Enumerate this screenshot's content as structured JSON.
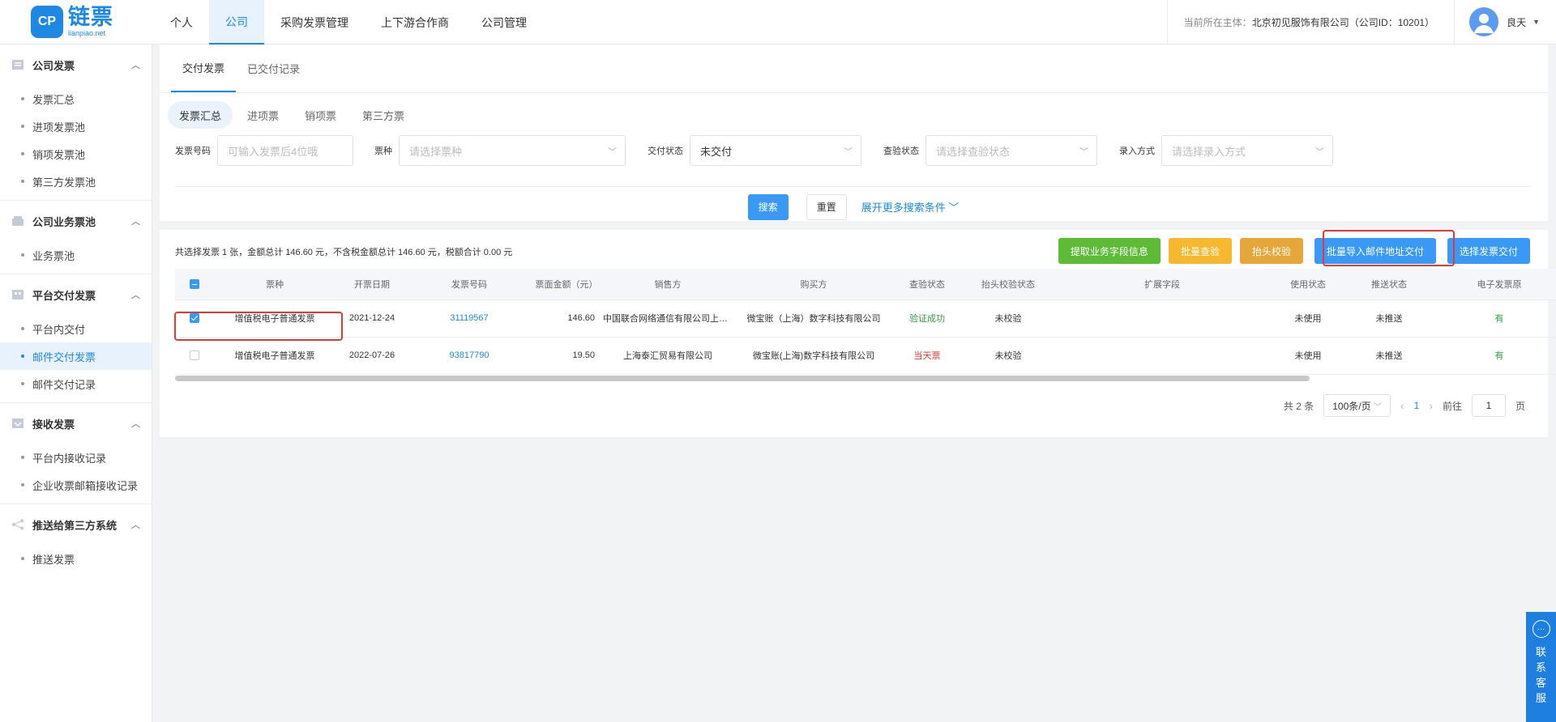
{
  "header": {
    "logo_mark": "CP",
    "logo_cn": "链票",
    "logo_en": "lianpiao.net",
    "nav": [
      {
        "label": "个人",
        "active": false
      },
      {
        "label": "公司",
        "active": true
      },
      {
        "label": "采购发票管理",
        "active": false
      },
      {
        "label": "上下游合作商",
        "active": false
      },
      {
        "label": "公司管理",
        "active": false
      }
    ],
    "entity_label": "当前所在主体：",
    "entity_value": "北京初见服饰有限公司（公司ID：10201）",
    "user_name": "良天",
    "user_caret": "▼"
  },
  "sidebar": {
    "groups": [
      {
        "title": "公司发票",
        "icon": "invoice-icon",
        "items": [
          "发票汇总",
          "进项发票池",
          "销项发票池",
          "第三方发票池"
        ]
      },
      {
        "title": "公司业务票池",
        "icon": "pool-icon",
        "items": [
          "业务票池"
        ]
      },
      {
        "title": "平台交付发票",
        "icon": "deliver-icon",
        "items": [
          "平台内交付",
          "邮件交付发票",
          "邮件交付记录"
        ]
      },
      {
        "title": "接收发票",
        "icon": "receive-icon",
        "items": [
          "平台内接收记录",
          "企业收票邮箱接收记录"
        ]
      },
      {
        "title": "推送给第三方系统",
        "icon": "share-icon",
        "items": [
          "推送发票"
        ]
      }
    ],
    "active_item": "邮件交付发票"
  },
  "tabs": [
    "交付发票",
    "已交付记录"
  ],
  "subtabs": [
    "发票汇总",
    "进项票",
    "销项票",
    "第三方票"
  ],
  "filters": {
    "invoice_no_label": "发票号码",
    "invoice_no_placeholder": "可输入发票后4位哦",
    "type_label": "票种",
    "type_placeholder": "请选择票种",
    "delivery_label": "交付状态",
    "delivery_value": "未交付",
    "check_label": "查验状态",
    "check_placeholder": "请选择查验状态",
    "entry_label": "录入方式",
    "entry_placeholder": "请选择录入方式"
  },
  "buttons": {
    "search": "搜索",
    "reset": "重置",
    "more": "展开更多搜索条件 ﹀"
  },
  "summary": "共选择发票 1 张，金额总计 146.60 元，不含税金额总计 146.60 元，税额合计 0.00 元",
  "actions": [
    {
      "label": "提取业务字段信息",
      "color": "#5dbb37"
    },
    {
      "label": "批量查验",
      "color": "#f5b82e"
    },
    {
      "label": "抬头校验",
      "color": "#e5a73a"
    },
    {
      "label": "批量导入邮件地址交付",
      "color": "#3a99f5"
    },
    {
      "label": "选择发票交付",
      "color": "#3a99f5"
    }
  ],
  "table": {
    "columns": [
      "票种",
      "开票日期",
      "发票号码",
      "票面金额（元）",
      "销售方",
      "购买方",
      "查验状态",
      "抬头校验状态",
      "扩展字段",
      "使用状态",
      "推送状态",
      "电子发票原"
    ],
    "rows": [
      {
        "checked": true,
        "type": "增值税电子普通发票",
        "date": "2021-12-24",
        "no": "31119567",
        "amount": "146.60",
        "seller": "中国联合网络通信有限公司上海…",
        "buyer": "微宝账（上海）数字科技有限公司",
        "check": "验证成功",
        "title_check": "未校验",
        "ext": "",
        "use": "未使用",
        "push": "未推送",
        "orig": "有"
      },
      {
        "checked": false,
        "type": "增值税电子普通发票",
        "date": "2022-07-26",
        "no": "93817790",
        "amount": "19.50",
        "seller": "上海泰汇贸易有限公司",
        "buyer": "微宝账(上海)数字科技有限公司",
        "check": "当天票",
        "title_check": "未校验",
        "ext": "",
        "use": "未使用",
        "push": "未推送",
        "orig": "有"
      }
    ]
  },
  "pager": {
    "total": "共 2 条",
    "size": "100条/页",
    "current": "1",
    "goto_label": "前往",
    "goto_value": "1",
    "page_unit": "页"
  },
  "contact": [
    "联",
    "系",
    "客",
    "服"
  ]
}
